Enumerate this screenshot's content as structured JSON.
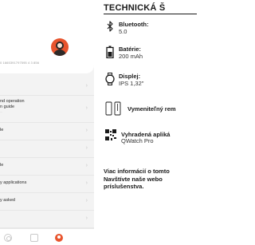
{
  "phone": {
    "device_id": "0 1665391797595 4 3 856",
    "menu": [
      {
        "label": "",
        "chevron": "›"
      },
      {
        "label": "nd operation\nn guide",
        "sub": "...",
        "chevron": "›"
      },
      {
        "label": "le",
        "chevron": "›"
      },
      {
        "label": "",
        "chevron": "›"
      },
      {
        "label": "le",
        "chevron": "›"
      },
      {
        "label": "y applications",
        "chevron": "›"
      },
      {
        "label": "y asked",
        "chevron": "›"
      },
      {
        "label": "",
        "chevron": "›"
      }
    ]
  },
  "spec": {
    "title": "TECHNICKÁ Š",
    "rows": [
      {
        "icon": "bluetooth-icon",
        "name": "Bluetooth:",
        "value": "5.0"
      },
      {
        "icon": "battery-icon",
        "name": "Batérie:",
        "value": "200 mAh"
      },
      {
        "icon": "watch-display-icon",
        "name": "Displej:",
        "value": "IPS 1,32\""
      },
      {
        "icon": "strap-icon",
        "name": "Vymeniteľný rem",
        "value": ""
      },
      {
        "icon": "qr-code-icon",
        "name": "Vyhradená apliká",
        "value": "QWatch Pro"
      }
    ],
    "info_lines": [
      "Viac informácií o tomto",
      "Navštívte naše webo",
      "príslušenstva."
    ]
  },
  "colors": {
    "accent": "#e8542d"
  }
}
